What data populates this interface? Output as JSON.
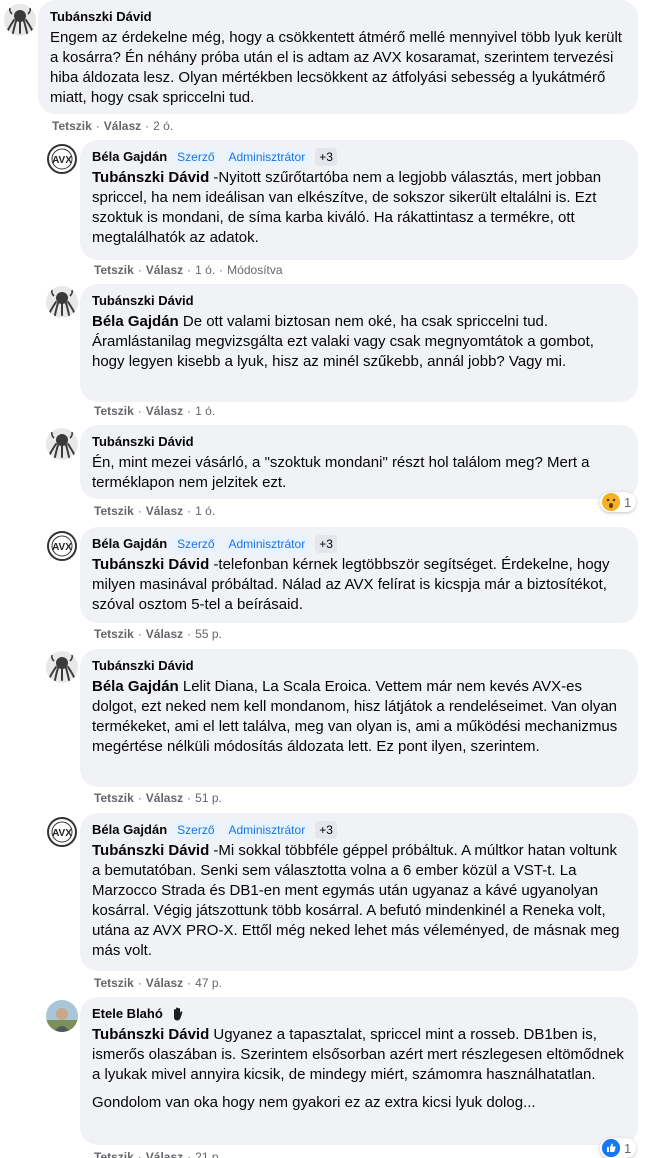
{
  "comments": [
    {
      "author": "Tubánszki Dávid",
      "paragraphs": [
        "Engem az érdekelne még, hogy a csökkentett átmérő mellé mennyivel több lyuk került a kosárra? Én néhány próba után el is adtam az AVX kosaramat, szerintem tervezési hiba áldozata lesz. Olyan mértékben lecsökkent az átfolyási sebesség a lyukátmérő miatt, hogy csak spriccelni tud."
      ],
      "like": "Tetszik",
      "reply": "Válasz",
      "time": "2 ó."
    },
    {
      "author": "Béla Gajdán",
      "badges": [
        "Szerző",
        "Adminisztrátor",
        "+3"
      ],
      "mention": "Tubánszki Dávid",
      "text": " -Nyitott szűrőtartóba nem a legjobb választás, mert jobban spriccel, ha nem ideálisan van elkészítve, de sokszor sikerült eltalálni is. Ezt szoktuk is mondani, de síma karba kiváló. Ha rákattintasz a termékre, ott megtalálhatók az adatok.",
      "like": "Tetszik",
      "reply": "Válasz",
      "time": "1 ó.",
      "edited": "Módosítva"
    },
    {
      "author": "Tubánszki Dávid",
      "mention": "Béla Gajdán",
      "text": " De ott valami biztosan nem oké, ha csak spriccelni tud. Áramlástanilag megvizsgálta ezt valaki vagy csak megnyomtátok a gombot, hogy legyen kisebb a lyuk, hisz az minél szűkebb, annál jobb? Vagy mi.",
      "like": "Tetszik",
      "reply": "Válasz",
      "time": "1 ó."
    },
    {
      "author": "Tubánszki Dávid",
      "text": "Én, mint mezei vásárló, a \"szoktuk mondani\" részt hol találom meg? Mert a terméklapon nem jelzitek ezt.",
      "like": "Tetszik",
      "reply": "Válasz",
      "time": "1 ó.",
      "reaction_count": "1"
    },
    {
      "author": "Béla Gajdán",
      "badges": [
        "Szerző",
        "Adminisztrátor",
        "+3"
      ],
      "mention": "Tubánszki Dávid",
      "text": " -telefonban kérnek legtöbbször segítséget. Érdekelne, hogy milyen masinával próbáltad. Nálad az AVX felírat is kicspja már a biztosítékot, szóval osztom 5-tel a beírásaid.",
      "like": "Tetszik",
      "reply": "Válasz",
      "time": "55 p."
    },
    {
      "author": "Tubánszki Dávid",
      "mention": "Béla Gajdán",
      "text": " Lelit Diana, La Scala Eroica. Vettem már nem kevés AVX-es dolgot, ezt neked nem kell mondanom, hisz látjátok a rendeléseimet. Van olyan termékeket, ami el lett találva, meg van olyan is, ami a működési mechanizmus megértése nélküli módosítás áldozata lett. Ez pont ilyen, szerintem.",
      "like": "Tetszik",
      "reply": "Válasz",
      "time": "51 p."
    },
    {
      "author": "Béla Gajdán",
      "badges": [
        "Szerző",
        "Adminisztrátor",
        "+3"
      ],
      "mention": "Tubánszki Dávid",
      "text": " -Mi sokkal többféle géppel próbáltuk. A múltkor hatan voltunk a bemutatóban. Senki sem választotta volna a 6 ember közül a VST-t. La Marzocco Strada és DB1-en ment egymás után ugyanaz a kávé ugyanolyan kosárral. Végig játszottunk több kosárral. A befutó mindenkinél a Reneka volt, utána az AVX PRO-X. Ettől még neked lehet más véleményed, de másnak meg más volt.",
      "like": "Tetszik",
      "reply": "Válasz",
      "time": "47 p."
    },
    {
      "author": "Etele Blahó",
      "mention": "Tubánszki Dávid",
      "text": " Ugyanez a tapasztalat, spriccel mint a rosseb. DB1ben is, ismerős olaszában is. Szerintem elsősorban azért mert részlegesen eltömődnek a lyukak mivel annyira kicsik, de mindegy miért, számomra használhatatlan.",
      "text2": "Gondolom van oka hogy nem gyakori ez az extra kicsi lyuk dolog...",
      "like": "Tetszik",
      "reply": "Válasz",
      "time": "21 p.",
      "reaction_count": "1"
    }
  ],
  "icons": {
    "avatar_tubanszki": "octopus-avatar-icon",
    "avatar_bela": "avx-logo-avatar-icon",
    "avatar_etele": "person-photo-avatar-icon",
    "wow_reaction": "wow-emoji-icon",
    "like_reaction": "like-thumb-icon",
    "waving_hand": "waving-hand-badge-icon"
  },
  "colors": {
    "bubble": "#f0f2f5",
    "badge_bg": "#e7f3ff",
    "badge_text": "#1b74e4",
    "meta_text": "#65676b"
  }
}
